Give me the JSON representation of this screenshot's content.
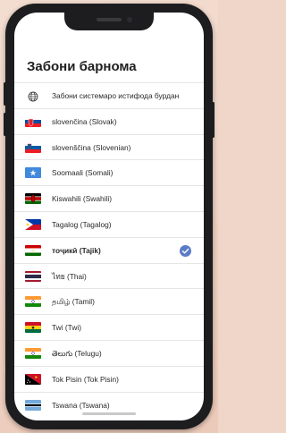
{
  "header": {
    "title": "Забони барнома"
  },
  "languages": [
    {
      "label": "Забони системаро истифода бурдан",
      "icon": "globe-icon",
      "selected": false
    },
    {
      "label": "slovenčina (Slovak)",
      "icon": "flag-slovakia-icon",
      "selected": false
    },
    {
      "label": "slovenščina (Slovenian)",
      "icon": "flag-slovenia-icon",
      "selected": false
    },
    {
      "label": "Soomaali (Somali)",
      "icon": "flag-somalia-icon",
      "selected": false
    },
    {
      "label": "Kiswahili (Swahili)",
      "icon": "flag-kenya-icon",
      "selected": false
    },
    {
      "label": "Tagalog (Tagalog)",
      "icon": "flag-philippines-icon",
      "selected": false
    },
    {
      "label": "тоҷикӣ (Tajik)",
      "icon": "flag-tajikistan-icon",
      "selected": true
    },
    {
      "label": "ไทย (Thai)",
      "icon": "flag-thailand-icon",
      "selected": false
    },
    {
      "label": "தமிழ் (Tamil)",
      "icon": "flag-india-icon",
      "selected": false
    },
    {
      "label": "Twi (Twi)",
      "icon": "flag-ghana-icon",
      "selected": false
    },
    {
      "label": "తెలుగు (Telugu)",
      "icon": "flag-india-icon",
      "selected": false
    },
    {
      "label": "Tok Pisin (Tok Pisin)",
      "icon": "flag-papua-new-guinea-icon",
      "selected": false
    },
    {
      "label": "Tswana (Tswana)",
      "icon": "flag-botswana-icon",
      "selected": false
    }
  ],
  "colors": {
    "accent": "#5b7cc7",
    "background": "#f0d6c9",
    "device": "#1d1d1f"
  }
}
